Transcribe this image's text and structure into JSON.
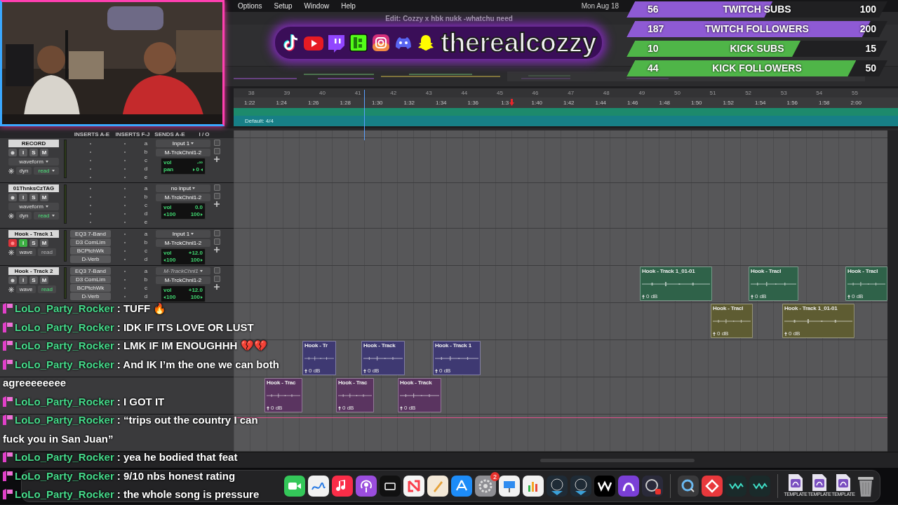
{
  "menu_bar": {
    "items": [
      "Options",
      "Setup",
      "Window",
      "Help"
    ],
    "clock": "Mon Aug 18"
  },
  "edit_window": {
    "title": "Edit: Cozzy x hbk nukk -whatchu need"
  },
  "ruler": {
    "bars": [
      "38",
      "39",
      "40",
      "41",
      "42",
      "43",
      "44",
      "45",
      "46",
      "47",
      "48",
      "49",
      "50",
      "51",
      "52",
      "53",
      "54",
      "55"
    ],
    "times": [
      "1:22",
      "1:24",
      "1:26",
      "1:28",
      "1:30",
      "1:32",
      "1:34",
      "1:36",
      "1:3",
      "1:40",
      "1:42",
      "1:44",
      "1:46",
      "1:48",
      "1:50",
      "1:52",
      "1:54",
      "1:56",
      "1:58",
      "2:00"
    ]
  },
  "tempo": {
    "meter": "Default: 4/4"
  },
  "mix_columns": [
    "INSERTS A-E",
    "INSERTS F-J",
    "SENDS A-E",
    "I / O"
  ],
  "tracks": [
    {
      "name": "RECORD",
      "kind": "expanded",
      "record_armed": false,
      "input_monitor": false,
      "buttons": [
        "I",
        "S",
        "M"
      ],
      "view": "waveform",
      "dynamic_label": "dyn",
      "automation_mode": "read",
      "automation_enabled": true,
      "sends": [
        "a",
        "b",
        "c",
        "d",
        "e"
      ],
      "input": "Input 1",
      "input_enabled": true,
      "output": "M-TrckChnl1-2",
      "vol_label": "vol",
      "vol": "-∞",
      "pan_label": "pan",
      "pan": [
        "0"
      ]
    },
    {
      "name": "01ThnksCzTAG",
      "kind": "expanded",
      "record_armed": false,
      "input_monitor": false,
      "buttons": [
        "I",
        "S",
        "M"
      ],
      "view": "waveform",
      "dynamic_label": "dyn",
      "automation_mode": "read",
      "automation_enabled": true,
      "sends": [
        "a",
        "b",
        "c",
        "d",
        "e"
      ],
      "input": "no input",
      "input_enabled": true,
      "output": "M-TrckChnl1-2",
      "vol_label": "vol",
      "vol": "0.0",
      "pan": [
        "100",
        "100"
      ]
    },
    {
      "name": "Hook - Track 1",
      "kind": "compact",
      "record_armed": true,
      "input_monitor": true,
      "buttons": [
        "I",
        "S",
        "M"
      ],
      "view": "wave",
      "automation_mode": "read",
      "automation_enabled": false,
      "inserts": [
        "EQ3 7-Band",
        "D3 ComLim",
        "BCPtchWk",
        "D-Verb"
      ],
      "sends": [
        "a",
        "b",
        "c",
        "d"
      ],
      "input": "Input 1",
      "input_enabled": true,
      "output": "M-TrckChnl1-2",
      "vol_label": "vol",
      "vol": "+12.0",
      "pan": [
        "100",
        "100"
      ]
    },
    {
      "name": "Hook - Track 2",
      "kind": "compact",
      "record_armed": false,
      "input_monitor": false,
      "buttons": [
        "I",
        "S",
        "M"
      ],
      "view": "wave",
      "automation_mode": "read",
      "automation_enabled": true,
      "inserts": [
        "EQ3 7-Band",
        "D3 ComLim",
        "BCPtchWk",
        "D-Verb"
      ],
      "sends": [
        "a",
        "b",
        "c",
        "d"
      ],
      "input": "M-TrackChnl1",
      "input_enabled": false,
      "output": "M-TrckChnl1-2",
      "vol_label": "vol",
      "vol": "+12.0",
      "pan": [
        "100",
        "100"
      ]
    }
  ],
  "clip_lanes": [
    {
      "clips": [
        {
          "label": "Hook - Track 1_01-01",
          "gain": "0 dB",
          "color": "#2f6249"
        },
        {
          "label": "Hook - Tracl",
          "gain": "0 dB",
          "color": "#2f6249"
        },
        {
          "label": "Hook - Tracl",
          "gain": "0 dB",
          "color": "#2f6249"
        }
      ]
    },
    {
      "clips": [
        {
          "label": "Hook - Tracl",
          "gain": "0 dB",
          "color": "#5e5c32"
        },
        {
          "label": "Hook - Track 1_01-01",
          "gain": "0 dB",
          "color": "#5e5c32"
        }
      ]
    },
    {
      "clips": [
        {
          "label": "Hook - Tr",
          "gain": "0 dB",
          "color": "#3e3972"
        },
        {
          "label": "Hook - Track",
          "gain": "0 dB",
          "color": "#3e3972"
        },
        {
          "label": "Hook - Track 1",
          "gain": "0 dB",
          "color": "#3e3972"
        }
      ]
    },
    {
      "clips": [
        {
          "label": "Hook - Trac",
          "gain": "0 dB",
          "color": "#5a3460"
        },
        {
          "label": "Hook - Trac",
          "gain": "0 dB",
          "color": "#5a3460"
        },
        {
          "label": "Hook - Track",
          "gain": "0 dB",
          "color": "#5a3460"
        }
      ]
    }
  ],
  "webcam": {
    "kind": "picture"
  },
  "logo_banner": {
    "handle": "therealcozzy"
  },
  "goals": [
    {
      "current": "56",
      "label": "TWITCH SUBS",
      "goal": "100",
      "level": 0.56,
      "color": "#8e5ad4"
    },
    {
      "current": "187",
      "label": "TWITCH FOLLOWERS",
      "goal": "200",
      "level": 0.935,
      "color": "#8e5ad4"
    },
    {
      "current": "10",
      "label": "KICK SUBS",
      "goal": "15",
      "level": 0.667,
      "color": "#4fb548"
    },
    {
      "current": "44",
      "label": "KICK FOLLOWERS",
      "goal": "50",
      "level": 0.88,
      "color": "#4fb548"
    }
  ],
  "chat": [
    {
      "user": "LoLo_Party_Rocker",
      "text": ": TUFF 🔥"
    },
    {
      "user": "LoLo_Party_Rocker",
      "text": ": IDK IF ITS LOVE OR LUST"
    },
    {
      "user": "LoLo_Party_Rocker",
      "text": ": LMK IF IM ENOUGHHH 💔💔"
    },
    {
      "user": "LoLo_Party_Rocker",
      "text": ": And IK I’m the one we can both",
      "continuation": "agreeeeeeee"
    },
    {
      "user": "LoLo_Party_Rocker",
      "text": ": I GOT IT"
    },
    {
      "user": "LoLo_Party_Rocker",
      "text": ": “trips out the country I can",
      "continuation": "fuck you in San Juan”"
    },
    {
      "user": "LoLo_Party_Rocker",
      "text": ": yea he bodied that feat"
    },
    {
      "user": "LoLo_Party_Rocker",
      "text": ": 9/10 nbs honest rating"
    },
    {
      "user": "LoLo_Party_Rocker",
      "text": ": the whole song is pressure"
    }
  ],
  "dock": {
    "badge": "2",
    "file_labels": [
      "TEMPLATE",
      "TEMPLATE",
      "TEMPLATE"
    ]
  }
}
